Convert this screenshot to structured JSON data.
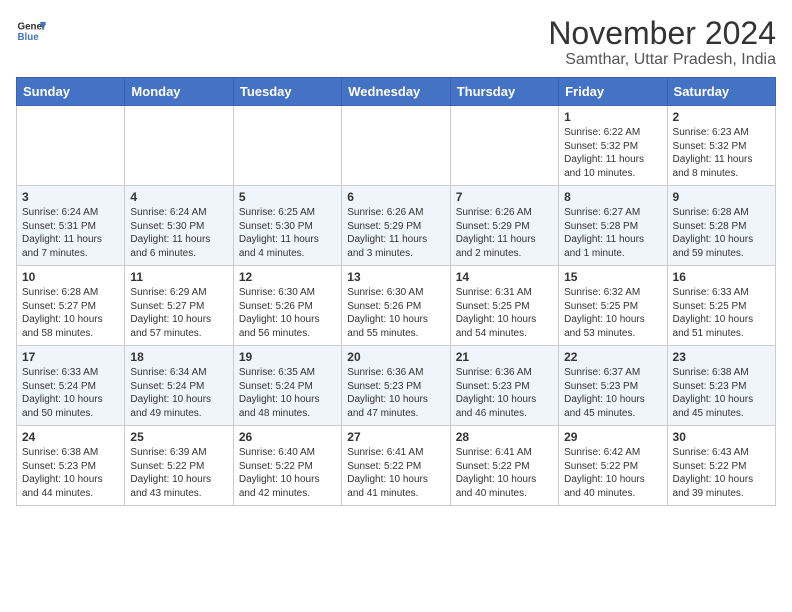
{
  "header": {
    "logo_line1": "General",
    "logo_line2": "Blue",
    "title": "November 2024",
    "subtitle": "Samthar, Uttar Pradesh, India"
  },
  "weekdays": [
    "Sunday",
    "Monday",
    "Tuesday",
    "Wednesday",
    "Thursday",
    "Friday",
    "Saturday"
  ],
  "weeks": [
    [
      {
        "day": "",
        "info": ""
      },
      {
        "day": "",
        "info": ""
      },
      {
        "day": "",
        "info": ""
      },
      {
        "day": "",
        "info": ""
      },
      {
        "day": "",
        "info": ""
      },
      {
        "day": "1",
        "info": "Sunrise: 6:22 AM\nSunset: 5:32 PM\nDaylight: 11 hours and 10 minutes."
      },
      {
        "day": "2",
        "info": "Sunrise: 6:23 AM\nSunset: 5:32 PM\nDaylight: 11 hours and 8 minutes."
      }
    ],
    [
      {
        "day": "3",
        "info": "Sunrise: 6:24 AM\nSunset: 5:31 PM\nDaylight: 11 hours and 7 minutes."
      },
      {
        "day": "4",
        "info": "Sunrise: 6:24 AM\nSunset: 5:30 PM\nDaylight: 11 hours and 6 minutes."
      },
      {
        "day": "5",
        "info": "Sunrise: 6:25 AM\nSunset: 5:30 PM\nDaylight: 11 hours and 4 minutes."
      },
      {
        "day": "6",
        "info": "Sunrise: 6:26 AM\nSunset: 5:29 PM\nDaylight: 11 hours and 3 minutes."
      },
      {
        "day": "7",
        "info": "Sunrise: 6:26 AM\nSunset: 5:29 PM\nDaylight: 11 hours and 2 minutes."
      },
      {
        "day": "8",
        "info": "Sunrise: 6:27 AM\nSunset: 5:28 PM\nDaylight: 11 hours and 1 minute."
      },
      {
        "day": "9",
        "info": "Sunrise: 6:28 AM\nSunset: 5:28 PM\nDaylight: 10 hours and 59 minutes."
      }
    ],
    [
      {
        "day": "10",
        "info": "Sunrise: 6:28 AM\nSunset: 5:27 PM\nDaylight: 10 hours and 58 minutes."
      },
      {
        "day": "11",
        "info": "Sunrise: 6:29 AM\nSunset: 5:27 PM\nDaylight: 10 hours and 57 minutes."
      },
      {
        "day": "12",
        "info": "Sunrise: 6:30 AM\nSunset: 5:26 PM\nDaylight: 10 hours and 56 minutes."
      },
      {
        "day": "13",
        "info": "Sunrise: 6:30 AM\nSunset: 5:26 PM\nDaylight: 10 hours and 55 minutes."
      },
      {
        "day": "14",
        "info": "Sunrise: 6:31 AM\nSunset: 5:25 PM\nDaylight: 10 hours and 54 minutes."
      },
      {
        "day": "15",
        "info": "Sunrise: 6:32 AM\nSunset: 5:25 PM\nDaylight: 10 hours and 53 minutes."
      },
      {
        "day": "16",
        "info": "Sunrise: 6:33 AM\nSunset: 5:25 PM\nDaylight: 10 hours and 51 minutes."
      }
    ],
    [
      {
        "day": "17",
        "info": "Sunrise: 6:33 AM\nSunset: 5:24 PM\nDaylight: 10 hours and 50 minutes."
      },
      {
        "day": "18",
        "info": "Sunrise: 6:34 AM\nSunset: 5:24 PM\nDaylight: 10 hours and 49 minutes."
      },
      {
        "day": "19",
        "info": "Sunrise: 6:35 AM\nSunset: 5:24 PM\nDaylight: 10 hours and 48 minutes."
      },
      {
        "day": "20",
        "info": "Sunrise: 6:36 AM\nSunset: 5:23 PM\nDaylight: 10 hours and 47 minutes."
      },
      {
        "day": "21",
        "info": "Sunrise: 6:36 AM\nSunset: 5:23 PM\nDaylight: 10 hours and 46 minutes."
      },
      {
        "day": "22",
        "info": "Sunrise: 6:37 AM\nSunset: 5:23 PM\nDaylight: 10 hours and 45 minutes."
      },
      {
        "day": "23",
        "info": "Sunrise: 6:38 AM\nSunset: 5:23 PM\nDaylight: 10 hours and 45 minutes."
      }
    ],
    [
      {
        "day": "24",
        "info": "Sunrise: 6:38 AM\nSunset: 5:23 PM\nDaylight: 10 hours and 44 minutes."
      },
      {
        "day": "25",
        "info": "Sunrise: 6:39 AM\nSunset: 5:22 PM\nDaylight: 10 hours and 43 minutes."
      },
      {
        "day": "26",
        "info": "Sunrise: 6:40 AM\nSunset: 5:22 PM\nDaylight: 10 hours and 42 minutes."
      },
      {
        "day": "27",
        "info": "Sunrise: 6:41 AM\nSunset: 5:22 PM\nDaylight: 10 hours and 41 minutes."
      },
      {
        "day": "28",
        "info": "Sunrise: 6:41 AM\nSunset: 5:22 PM\nDaylight: 10 hours and 40 minutes."
      },
      {
        "day": "29",
        "info": "Sunrise: 6:42 AM\nSunset: 5:22 PM\nDaylight: 10 hours and 40 minutes."
      },
      {
        "day": "30",
        "info": "Sunrise: 6:43 AM\nSunset: 5:22 PM\nDaylight: 10 hours and 39 minutes."
      }
    ]
  ]
}
